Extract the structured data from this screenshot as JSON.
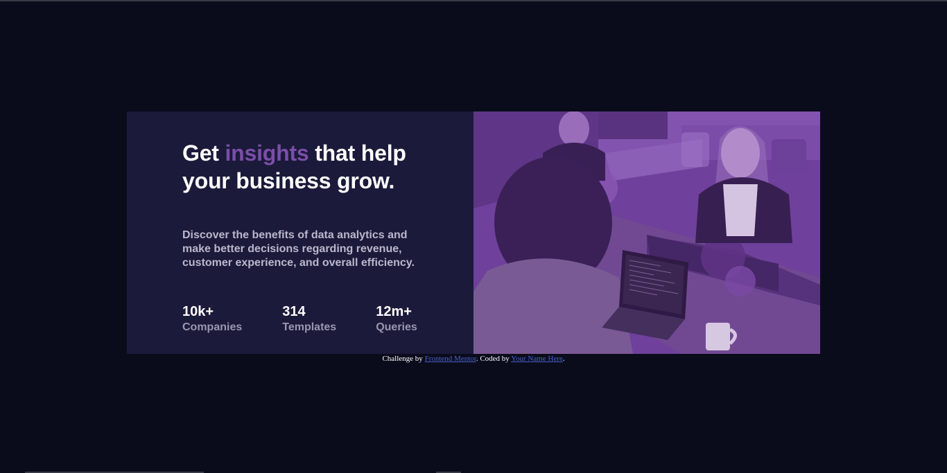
{
  "card": {
    "headline": {
      "before": "Get ",
      "accent": "insights",
      "after": " that help your business grow."
    },
    "description": "Discover the benefits of data analytics and make better decisions regarding revenue, customer experience, and overall efficiency.",
    "stats": [
      {
        "value": "10k+",
        "label": "Companies"
      },
      {
        "value": "314",
        "label": "Templates"
      },
      {
        "value": "12m+",
        "label": "Queries"
      }
    ],
    "image": {
      "tint_color": "#7a48a8"
    }
  },
  "attribution": {
    "prefix": "Challenge by ",
    "link1": "Frontend Mentor",
    "middle": ". Coded by ",
    "link2": "Your Name Here",
    "suffix": "."
  },
  "colors": {
    "page_background": "#0a0c1c",
    "card_background": "#1b1a3a",
    "accent": "#7b4ea8",
    "link": "#4a62c9"
  }
}
